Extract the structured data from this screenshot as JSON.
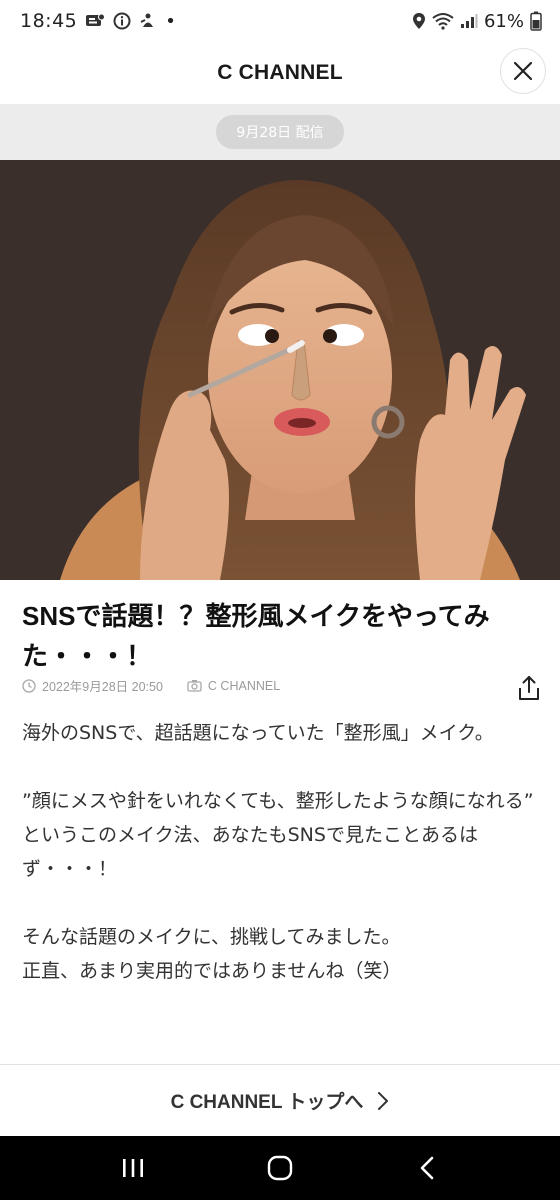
{
  "status_bar": {
    "time": "18:45",
    "battery": "61%",
    "dot": "•",
    "icons_left": [
      "message-icon",
      "info-icon",
      "notification-icon"
    ],
    "icons_right": [
      "location-icon",
      "wifi-icon",
      "signal-icon",
      "battery-icon"
    ]
  },
  "header": {
    "title": "C CHANNEL",
    "close_icon": "close-icon"
  },
  "date_band": {
    "label": "9月28日 配信"
  },
  "article": {
    "title": "SNSで話題！？整形風メイクをやってみた・・・！",
    "date": "2022年9月28日 20:50",
    "source": "C CHANNEL",
    "share_icon": "share-icon",
    "paragraphs": [
      "海外のSNSで、超話題になっていた「整形風」メイク。",
      "",
      "”顔にメスや針をいれなくても、整形したような顔になれる”",
      "というこのメイク法、あなたもSNSで見たことあるはず・・・！",
      "",
      "そんな話題のメイクに、挑戦してみました。",
      "正直、あまり実用的ではありませんね（笑）"
    ]
  },
  "footer": {
    "link_label": "C CHANNEL トップへ"
  },
  "nav": {
    "items": [
      "recents-icon",
      "home-icon",
      "back-icon"
    ]
  },
  "colors": {
    "hero_bg": "#3b2f2b",
    "date_band_bg": "#ececec",
    "date_pill_bg": "#d6d6d6",
    "nav_bg": "#000000"
  }
}
